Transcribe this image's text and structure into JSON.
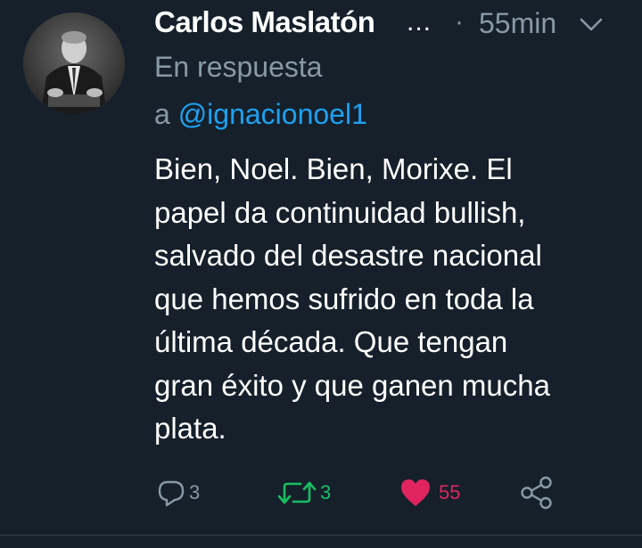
{
  "tweet": {
    "author_name": "Carlos Maslatón",
    "truncation": "...",
    "separator": "·",
    "timestamp": "55min",
    "reply_prefix": "En respuesta",
    "reply_to_word": "a",
    "reply_to_handle": "@ignacionoel1",
    "body_lines": [
      "Bien, Noel. Bien, Morixe. El",
      "papel da continuidad bullish,",
      "salvado del desastre nacional",
      "que hemos sufrido en toda la",
      "última década. Que tengan",
      "gran éxito y que ganen mucha",
      "plata."
    ]
  },
  "actions": {
    "reply_count": "3",
    "retweet_count": "3",
    "like_count": "55"
  },
  "icons": {
    "reply": "reply-icon",
    "retweet": "retweet-icon",
    "like": "heart-icon",
    "share": "share-icon",
    "menu": "chevron-down-icon"
  },
  "colors": {
    "background": "#15202b",
    "text": "#ffffff",
    "muted": "#8899a6",
    "link": "#1da1f2",
    "retweet": "#17bf63",
    "like": "#e0245e"
  }
}
